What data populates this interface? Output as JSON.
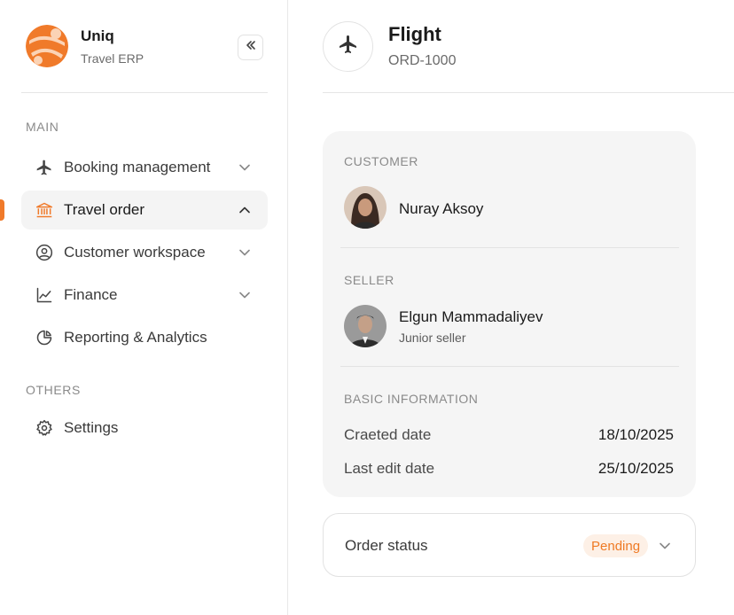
{
  "brand": {
    "name": "Uniq",
    "subtitle": "Travel ERP",
    "accent": "#f07a2a"
  },
  "sidebar": {
    "main_label": "MAIN",
    "others_label": "OTHERS",
    "items": [
      {
        "label": "Booking management",
        "icon": "plane-icon",
        "expanded": false
      },
      {
        "label": "Travel order",
        "icon": "bank-icon",
        "expanded": true,
        "active": true
      },
      {
        "label": "Customer workspace",
        "icon": "user-circle-icon",
        "expanded": false
      },
      {
        "label": "Finance",
        "icon": "chart-line-icon",
        "expanded": false
      },
      {
        "label": "Reporting & Analytics",
        "icon": "pie-chart-icon"
      }
    ],
    "others": [
      {
        "label": "Settings",
        "icon": "gear-icon"
      }
    ]
  },
  "header": {
    "title": "Flight",
    "subtitle": "ORD-1000",
    "icon": "plane-icon"
  },
  "details": {
    "customer_label": "CUSTOMER",
    "customer_name": "Nuray Aksoy",
    "seller_label": "SELLER",
    "seller_name": "Elgun Mammadaliyev",
    "seller_role": "Junior seller",
    "basic_label": "BASIC INFORMATION",
    "created_label": "Craeted date",
    "created_value": "18/10/2025",
    "edited_label": "Last edit date",
    "edited_value": "25/10/2025"
  },
  "status": {
    "label": "Order status",
    "value": "Pending",
    "badge_bg": "#fdf0e6",
    "badge_fg": "#ef7a24"
  }
}
